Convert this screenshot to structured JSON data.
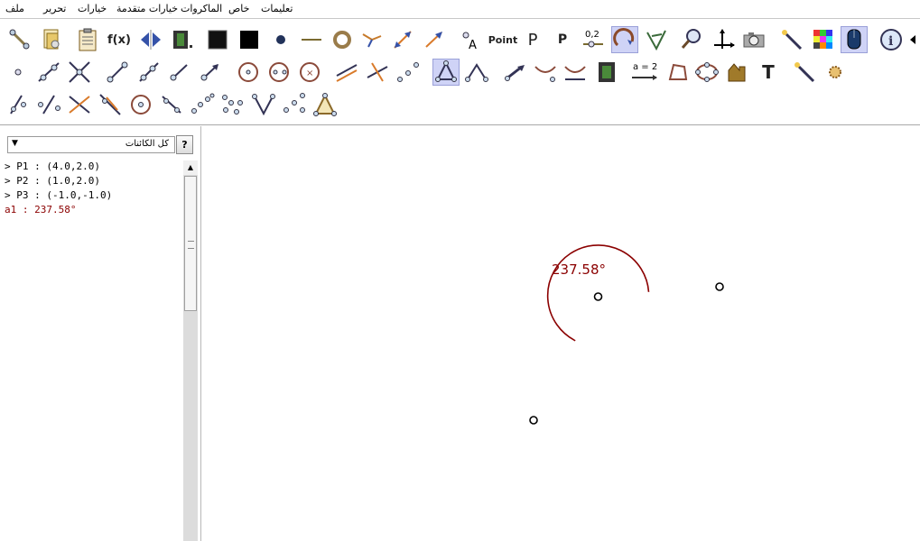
{
  "menu": {
    "items": [
      {
        "id": "file",
        "label": "ملف"
      },
      {
        "id": "edit",
        "label": "تحرير"
      },
      {
        "id": "options",
        "label": "خيارات"
      },
      {
        "id": "advanced",
        "label": "خيارات متقدمة"
      },
      {
        "id": "macros",
        "label": "الماكروات"
      },
      {
        "id": "special",
        "label": "خاص"
      },
      {
        "id": "help",
        "label": "تعليمات"
      }
    ]
  },
  "toolbar": {
    "fx_label": "f(x)",
    "point_label": "Point",
    "p_label": "P",
    "p_small_label": "P",
    "num_label": "0,2",
    "a_eq_label": "a = 2",
    "text_tool_label": "T",
    "a_label": "A",
    "icons": {
      "move": "move-point-icon",
      "properties": "properties-icon",
      "clipboard": "clipboard-icon",
      "fx": "function-icon",
      "reflect": "reflect-icon",
      "film": "animation-icon",
      "black_square_1": "fill-square-icon",
      "black_square_2": "fill-square-icon",
      "dot": "dot-icon",
      "segment": "segment-icon",
      "ring": "ring-icon",
      "angle_tool": "angle-tool-icon",
      "arrow_diag": "diagonal-arrow-icon",
      "vector": "vector-icon",
      "label_a": "label-icon",
      "point_text": "point-text-icon",
      "p_text": "p-text-icon",
      "p_small": "p-small-icon",
      "number": "number-slider-icon",
      "arc": "arc-tool-icon",
      "angle": "angle-icon",
      "zoom": "zoom-icon",
      "axes": "axes-icon",
      "camera": "camera-icon",
      "magic_wand": "magic-wand-icon",
      "color_palette": "color-palette-icon",
      "mouse": "mouse-icon",
      "info": "info-icon",
      "expand": "expand-arrow-icon"
    }
  },
  "algebra": {
    "filter_value": "كل الكائنات",
    "help_label": "?",
    "rows": [
      {
        "text": "> P1 : (4.0,2.0)",
        "type": "free"
      },
      {
        "text": "> P2 : (1.0,2.0)",
        "type": "free"
      },
      {
        "text": "> P3 : (-1.0,-1.0)",
        "type": "free"
      },
      {
        "text": "a1 : 237.58°",
        "type": "dependent"
      }
    ]
  },
  "graphics": {
    "angle_label": "237.58°",
    "angle_color": "#8b0000",
    "points": [
      {
        "name": "P1"
      },
      {
        "name": "P2"
      },
      {
        "name": "P3"
      }
    ]
  },
  "colors": {
    "selected_tool_bg": "#cfd3f6",
    "point_stroke": "#000000"
  }
}
